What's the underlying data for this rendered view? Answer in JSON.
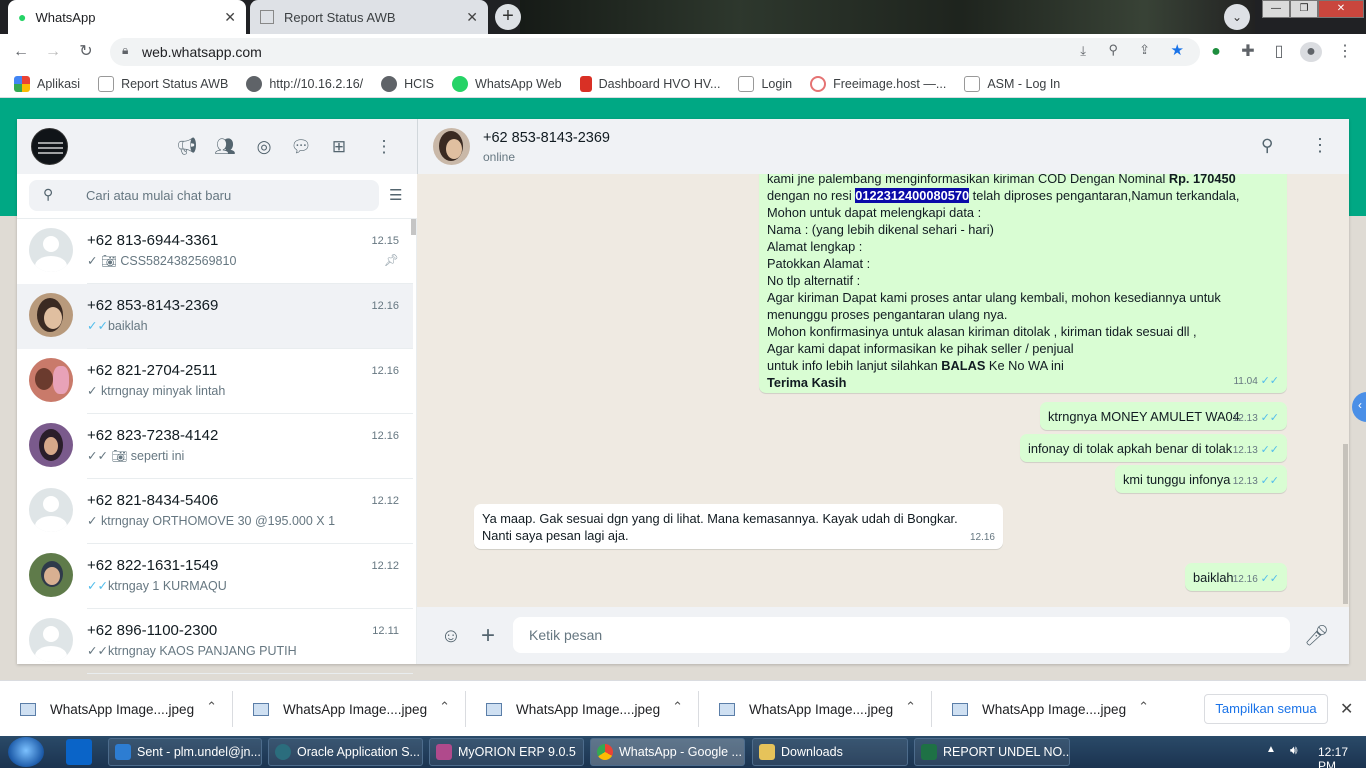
{
  "browser": {
    "tabs": [
      {
        "title": "WhatsApp",
        "active": true
      },
      {
        "title": "Report Status AWB",
        "active": false
      }
    ],
    "url": "web.whatsapp.com",
    "bookmarks": [
      "Aplikasi",
      "Report Status AWB",
      "http://10.16.2.16/",
      "HCIS",
      "WhatsApp Web",
      "Dashboard HVO HV...",
      "Login",
      "Freeimage.host —...",
      "ASM - Log In"
    ]
  },
  "sidebar": {
    "search_placeholder": "Cari atau mulai chat baru",
    "chats": [
      {
        "name": "+62 813-6944-3361",
        "time": "12.15",
        "preview": "CSS5824382569810",
        "tick": "✓",
        "read": false,
        "photo": true,
        "pinned": true
      },
      {
        "name": "+62 853-8143-2369",
        "time": "12.16",
        "preview": "baiklah",
        "tick": "✓✓",
        "read": true,
        "photo": false,
        "selected": true
      },
      {
        "name": "+62 821-2704-2511",
        "time": "12.16",
        "preview": "ktrngnay minyak lintah",
        "tick": "✓",
        "read": false,
        "photo": false
      },
      {
        "name": "+62 823-7238-4142",
        "time": "12.16",
        "preview": "seperti ini",
        "tick": "✓✓",
        "read": false,
        "photo": true
      },
      {
        "name": "+62 821-8434-5406",
        "time": "12.12",
        "preview": "ktrngnay ORTHOMOVE 30 @195.000 X 1",
        "tick": "✓",
        "read": false,
        "photo": false
      },
      {
        "name": "+62 822-1631-1549",
        "time": "12.12",
        "preview": "ktrngay 1 KURMAQU",
        "tick": "✓✓",
        "read": true,
        "photo": false
      },
      {
        "name": "+62 896-1100-2300",
        "time": "12.11",
        "preview": "ktrngnay KAOS PANJANG PUTIH",
        "tick": "✓✓",
        "read": false,
        "photo": false
      }
    ]
  },
  "conversation": {
    "name": "+62 853-8143-2369",
    "status": "online",
    "long_message": {
      "line1_a": "kami jne palembang menginformasikan kiriman  COD Dengan Nominal ",
      "line1_b": "Rp. 170450",
      "line2_a": "dengan no resi ",
      "awb": "0122312400080570",
      "line2_b": " telah diproses pengantaran,Namun terkandala,",
      "lines": [
        "Mohon untuk dapat melengkapi data :",
        "Nama : (yang lebih dikenal sehari - hari)",
        "Alamat  lengkap :",
        "Patokkan Alamat :",
        "No tlp alternatif :",
        "Agar kiriman Dapat kami proses antar ulang kembali, mohon kesediannya untuk",
        "menunggu proses pengantaran ulang nya.",
        "Mohon konfirmasinya untuk alasan kiriman ditolak , kiriman tidak sesuai dll ,",
        "Agar kami dapat informasikan ke pihak seller / penjual"
      ],
      "last_a": "untuk info lebih lanjut silahkan ",
      "last_b": "BALAS",
      "last_c": " Ke No WA ini",
      "closing": "Terima Kasih",
      "time": "11.04"
    },
    "messages": [
      {
        "text": "ktrngnya MONEY AMULET WA04",
        "time": "12.13",
        "dir": "out"
      },
      {
        "text": "infonay di tolak apkah benar di tolak",
        "time": "12.13",
        "dir": "out"
      },
      {
        "text": "kmi tunggu infonya",
        "time": "12.13",
        "dir": "out"
      },
      {
        "text": "Ya maap. Gak sesuai dgn yang di lihat. Mana kemasannya. Kayak udah di Bongkar. Nanti saya pesan lagi aja.",
        "time": "12.16",
        "dir": "in"
      },
      {
        "text": "baiklah",
        "time": "12.16",
        "dir": "out"
      }
    ],
    "composer_placeholder": "Ketik pesan"
  },
  "downloads": {
    "items": [
      "WhatsApp Image....jpeg",
      "WhatsApp Image....jpeg",
      "WhatsApp Image....jpeg",
      "WhatsApp Image....jpeg",
      "WhatsApp Image....jpeg"
    ],
    "show_all": "Tampilkan semua"
  },
  "taskbar": {
    "items": [
      "Sent - plm.undel@jn...",
      "Oracle Application S...",
      "MyORION ERP 9.0.5",
      "WhatsApp - Google ...",
      "Downloads",
      "REPORT UNDEL NO..."
    ],
    "clock": "12:17 PM"
  },
  "colors": {
    "accent": "#00a884",
    "outgoing": "#d9fdd3",
    "read_tick": "#53bdeb",
    "wallpaper": "#efeae2"
  }
}
